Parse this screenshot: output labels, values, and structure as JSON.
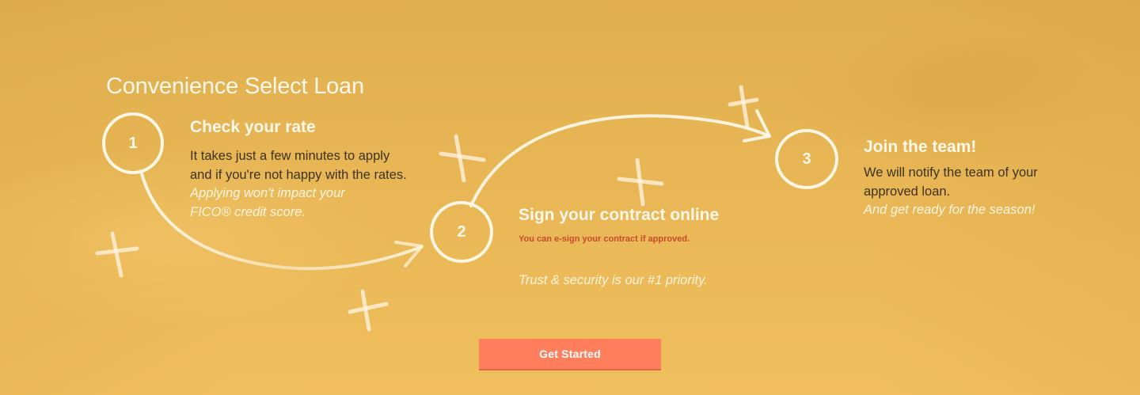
{
  "hero": {
    "title": "Convenience Select Loan",
    "background_color": "#e8b655",
    "accent_color": "#ff7f5c",
    "decoration_icon": "cross-mark-icon"
  },
  "steps": [
    {
      "number": "1",
      "heading": "Check your rate",
      "line1": "It takes just a few minutes to apply",
      "line2": "and if you're not happy with the rates.",
      "italic1": "Applying won't impact your",
      "italic2": "FICO® credit score."
    },
    {
      "number": "2",
      "heading": "Sign your contract online",
      "note": "You can e-sign your contract if approved.",
      "tagline": "Trust & security is our #1 priority."
    },
    {
      "number": "3",
      "heading": "Join the team!",
      "line1": "We will notify the team of your",
      "line2": "approved loan.",
      "italic1": "And get ready for the season!"
    }
  ],
  "cta": {
    "label": "Get Started"
  }
}
